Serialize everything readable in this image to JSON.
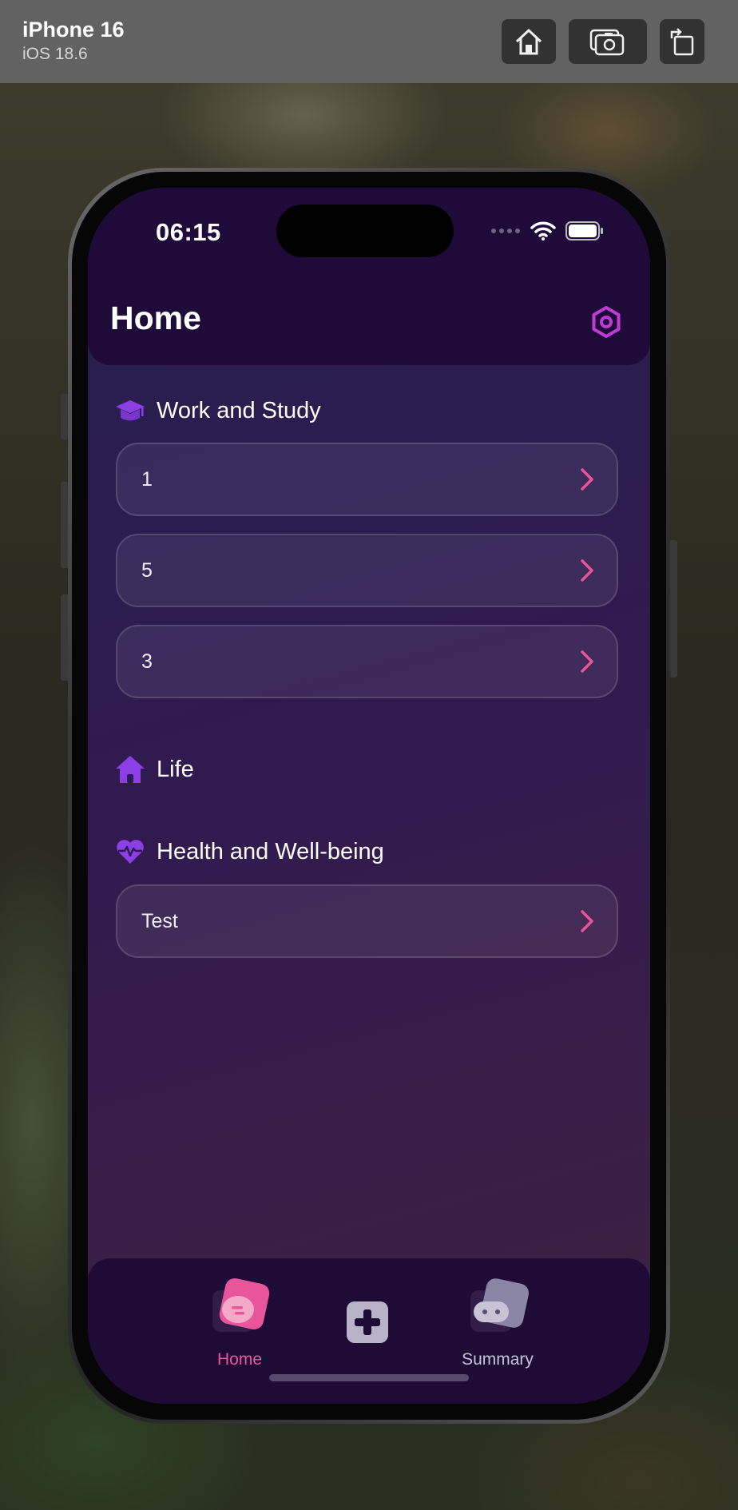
{
  "simulator": {
    "device_name": "iPhone 16",
    "os_version": "iOS 18.6",
    "buttons": [
      "home-icon",
      "screenshot-icon",
      "rotate-icon"
    ]
  },
  "status_bar": {
    "time": "06:15"
  },
  "header": {
    "title": "Home",
    "settings_icon": "gear-hexagon-icon"
  },
  "sections": [
    {
      "title": "Work and Study",
      "icon": "graduation-cap-icon",
      "items": [
        {
          "label": "1"
        },
        {
          "label": "5"
        },
        {
          "label": "3"
        }
      ]
    },
    {
      "title": "Life",
      "icon": "house-icon",
      "items": []
    },
    {
      "title": "Health and Well-being",
      "icon": "heart-pulse-icon",
      "items": [
        {
          "label": "Test"
        }
      ]
    }
  ],
  "tabbar": {
    "tabs": [
      {
        "label": "Home",
        "icon": "home-chat-icon",
        "active": true
      },
      {
        "label": "",
        "icon": "plus-icon",
        "active": false
      },
      {
        "label": "Summary",
        "icon": "robot-chat-icon",
        "active": false
      }
    ]
  },
  "colors": {
    "accent": "#e9559a",
    "section_icon": "#8d3fe6",
    "header_bg": "#1e0b3a",
    "inactive_tab": "#c9c3d6"
  }
}
